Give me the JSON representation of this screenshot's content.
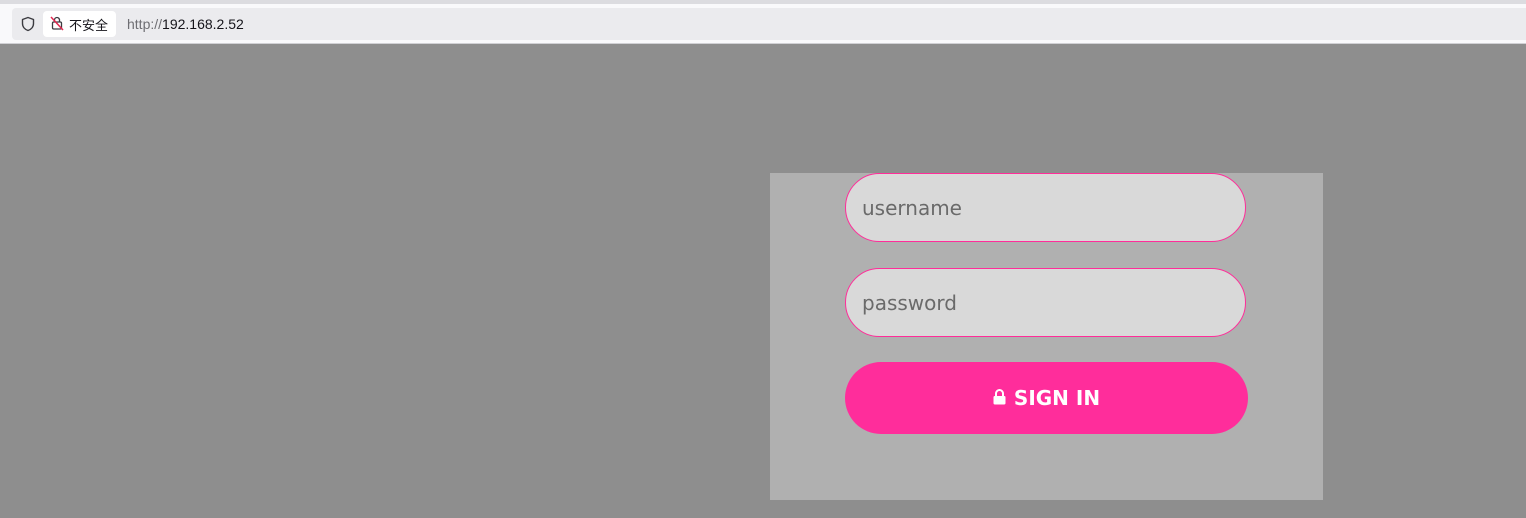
{
  "browser": {
    "security_label": "不安全",
    "url_protocol": "http://",
    "url_host": "192.168.2.52",
    "icons": [
      "shield-icon",
      "insecure-lock-icon"
    ]
  },
  "login": {
    "username_placeholder": "username",
    "password_placeholder": "password",
    "signin_label": "SIGN IN",
    "signin_icon": "lock-icon"
  },
  "colors": {
    "page_background": "#8e8e8e",
    "panel_background": "#b0b0b0",
    "accent": "#ff2d9b",
    "field_background": "#d9d9d9"
  }
}
